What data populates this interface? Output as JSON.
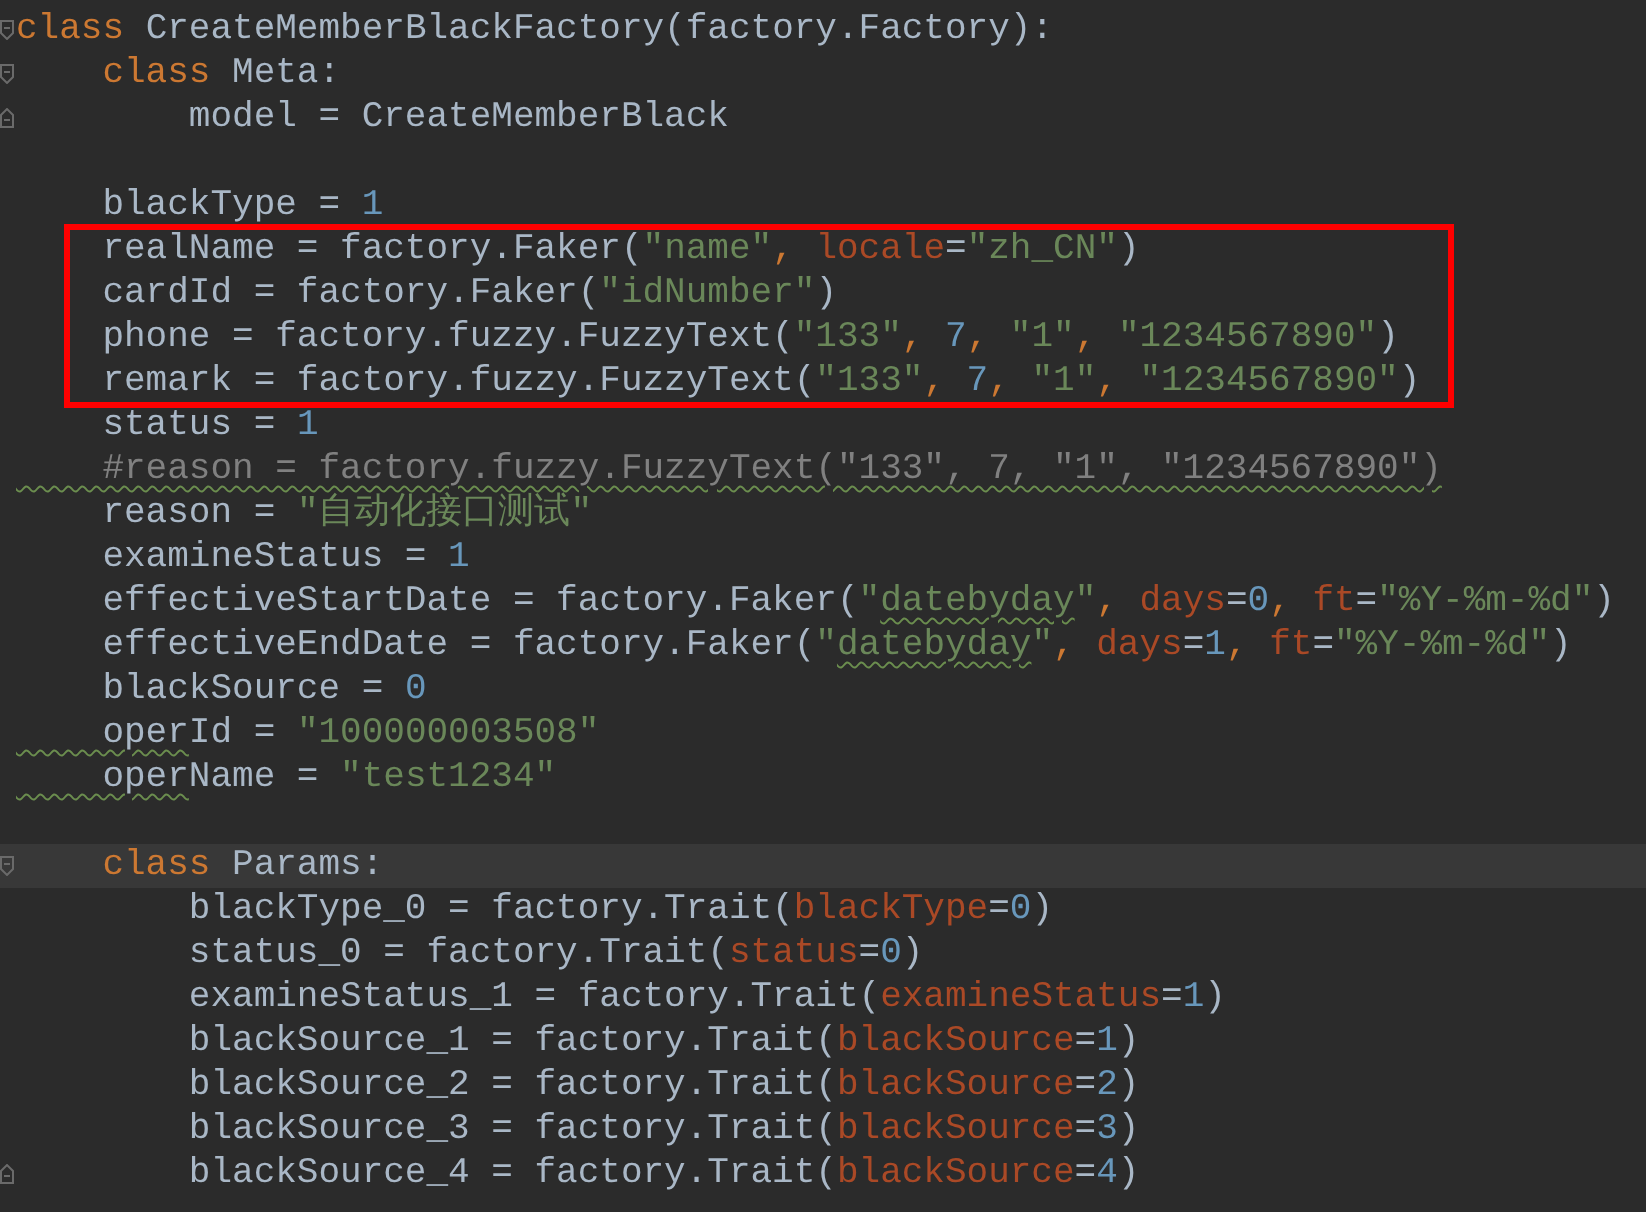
{
  "lines": [
    {
      "kind": "code",
      "fold_start": true,
      "fold_end": false,
      "current": false,
      "tokens": [
        {
          "kind": "keyword",
          "text": "class"
        },
        {
          "kind": "plain",
          "text": " CreateMemberBlackFactory(factory.Factory):"
        }
      ]
    },
    {
      "kind": "code",
      "fold_start": true,
      "fold_end": false,
      "current": false,
      "tokens": [
        {
          "kind": "keyword",
          "text": "    class"
        },
        {
          "kind": "plain",
          "text": " Meta:"
        }
      ]
    },
    {
      "kind": "code",
      "fold_start": false,
      "fold_end": true,
      "current": false,
      "tokens": [
        {
          "kind": "plain",
          "text": "        model = CreateMemberBlack"
        }
      ]
    },
    {
      "kind": "blank"
    },
    {
      "kind": "code",
      "fold_start": false,
      "fold_end": false,
      "current": false,
      "tokens": [
        {
          "kind": "plain",
          "text": "    blackType = "
        },
        {
          "kind": "number",
          "text": "1"
        }
      ]
    },
    {
      "kind": "boxed",
      "lines": [
        {
          "kind": "code",
          "fold_start": false,
          "fold_end": false,
          "current": false,
          "tokens": [
            {
              "kind": "plain",
              "text": "    realName = factory.Faker("
            },
            {
              "kind": "string",
              "text": "\"name\""
            },
            {
              "kind": "keyword",
              "text": ", "
            },
            {
              "kind": "argument",
              "text": "locale"
            },
            {
              "kind": "plain",
              "text": "="
            },
            {
              "kind": "string",
              "text": "\"zh_CN\""
            },
            {
              "kind": "plain",
              "text": ")"
            }
          ]
        },
        {
          "kind": "code",
          "fold_start": false,
          "fold_end": false,
          "current": false,
          "tokens": [
            {
              "kind": "plain",
              "text": "    cardId = factory.Faker("
            },
            {
              "kind": "string",
              "text": "\"idNumber\""
            },
            {
              "kind": "plain",
              "text": ")"
            }
          ]
        },
        {
          "kind": "code",
          "fold_start": false,
          "fold_end": false,
          "current": false,
          "tokens": [
            {
              "kind": "plain",
              "text": "    phone = factory.fuzzy.FuzzyText("
            },
            {
              "kind": "string",
              "text": "\"133\""
            },
            {
              "kind": "keyword",
              "text": ", "
            },
            {
              "kind": "number",
              "text": "7"
            },
            {
              "kind": "keyword",
              "text": ", "
            },
            {
              "kind": "string",
              "text": "\"1\""
            },
            {
              "kind": "keyword",
              "text": ", "
            },
            {
              "kind": "string",
              "text": "\"1234567890\""
            },
            {
              "kind": "plain",
              "text": ")"
            }
          ]
        },
        {
          "kind": "code",
          "fold_start": false,
          "fold_end": false,
          "current": false,
          "tokens": [
            {
              "kind": "plain",
              "text": "    remark = factory.fuzzy.FuzzyText("
            },
            {
              "kind": "string",
              "text": "\"133\""
            },
            {
              "kind": "keyword",
              "text": ", "
            },
            {
              "kind": "number",
              "text": "7"
            },
            {
              "kind": "keyword",
              "text": ", "
            },
            {
              "kind": "string",
              "text": "\"1\""
            },
            {
              "kind": "keyword",
              "text": ", "
            },
            {
              "kind": "string",
              "text": "\"1234567890\""
            },
            {
              "kind": "plain",
              "text": ")"
            }
          ]
        }
      ]
    },
    {
      "kind": "code",
      "fold_start": false,
      "fold_end": false,
      "current": false,
      "tokens": [
        {
          "kind": "plain",
          "text": "    status = "
        },
        {
          "kind": "number",
          "text": "1"
        }
      ]
    },
    {
      "kind": "code",
      "fold_start": false,
      "fold_end": false,
      "current": false,
      "tokens": [
        {
          "kind": "comment",
          "text": "    #reason = factory.fuzzy.FuzzyText(\"133\", 7, \"1\", \"1234567890\")",
          "typo": true
        }
      ]
    },
    {
      "kind": "code",
      "fold_start": false,
      "fold_end": false,
      "current": false,
      "tokens": [
        {
          "kind": "plain",
          "text": "    reason = "
        },
        {
          "kind": "string",
          "text": "\"自动化接口测试\""
        }
      ]
    },
    {
      "kind": "code",
      "fold_start": false,
      "fold_end": false,
      "current": false,
      "tokens": [
        {
          "kind": "plain",
          "text": "    examineStatus = "
        },
        {
          "kind": "number",
          "text": "1"
        }
      ]
    },
    {
      "kind": "code",
      "fold_start": false,
      "fold_end": false,
      "current": false,
      "tokens": [
        {
          "kind": "plain",
          "text": "    effectiveStartDate = factory.Faker("
        },
        {
          "kind": "string",
          "text": "\""
        },
        {
          "kind": "string",
          "text": "datebyday",
          "typo": true
        },
        {
          "kind": "string",
          "text": "\""
        },
        {
          "kind": "keyword",
          "text": ", "
        },
        {
          "kind": "argument",
          "text": "days"
        },
        {
          "kind": "plain",
          "text": "="
        },
        {
          "kind": "number",
          "text": "0"
        },
        {
          "kind": "keyword",
          "text": ", "
        },
        {
          "kind": "argument",
          "text": "ft"
        },
        {
          "kind": "plain",
          "text": "="
        },
        {
          "kind": "string",
          "text": "\"%Y-%m-%d\""
        },
        {
          "kind": "plain",
          "text": ")"
        }
      ]
    },
    {
      "kind": "code",
      "fold_start": false,
      "fold_end": false,
      "current": false,
      "tokens": [
        {
          "kind": "plain",
          "text": "    effectiveEndDate = factory.Faker("
        },
        {
          "kind": "string",
          "text": "\""
        },
        {
          "kind": "string",
          "text": "datebyday",
          "typo": true
        },
        {
          "kind": "string",
          "text": "\""
        },
        {
          "kind": "keyword",
          "text": ", "
        },
        {
          "kind": "argument",
          "text": "days"
        },
        {
          "kind": "plain",
          "text": "="
        },
        {
          "kind": "number",
          "text": "1"
        },
        {
          "kind": "keyword",
          "text": ", "
        },
        {
          "kind": "argument",
          "text": "ft"
        },
        {
          "kind": "plain",
          "text": "="
        },
        {
          "kind": "string",
          "text": "\"%Y-%m-%d\""
        },
        {
          "kind": "plain",
          "text": ")"
        }
      ]
    },
    {
      "kind": "code",
      "fold_start": false,
      "fold_end": false,
      "current": false,
      "tokens": [
        {
          "kind": "plain",
          "text": "    blackSource = "
        },
        {
          "kind": "number",
          "text": "0"
        }
      ]
    },
    {
      "kind": "code",
      "fold_start": false,
      "fold_end": false,
      "current": false,
      "tokens": [
        {
          "kind": "plain",
          "text": "    oper",
          "typo": true
        },
        {
          "kind": "plain",
          "text": "Id = "
        },
        {
          "kind": "string",
          "text": "\"100000003508\""
        }
      ]
    },
    {
      "kind": "code",
      "fold_start": false,
      "fold_end": false,
      "current": false,
      "tokens": [
        {
          "kind": "plain",
          "text": "    oper",
          "typo": true
        },
        {
          "kind": "plain",
          "text": "Name = "
        },
        {
          "kind": "string",
          "text": "\"test1234\""
        }
      ]
    },
    {
      "kind": "blank"
    },
    {
      "kind": "code",
      "fold_start": true,
      "fold_end": false,
      "current": true,
      "tokens": [
        {
          "kind": "keyword",
          "text": "    class"
        },
        {
          "kind": "plain",
          "text": " Params:"
        }
      ]
    },
    {
      "kind": "code",
      "fold_start": false,
      "fold_end": false,
      "current": false,
      "tokens": [
        {
          "kind": "plain",
          "text": "        blackType_0 = factory.Trait("
        },
        {
          "kind": "argument",
          "text": "blackType"
        },
        {
          "kind": "plain",
          "text": "="
        },
        {
          "kind": "number",
          "text": "0"
        },
        {
          "kind": "plain",
          "text": ")"
        }
      ]
    },
    {
      "kind": "code",
      "fold_start": false,
      "fold_end": false,
      "current": false,
      "tokens": [
        {
          "kind": "plain",
          "text": "        status_0 = factory.Trait("
        },
        {
          "kind": "argument",
          "text": "status"
        },
        {
          "kind": "plain",
          "text": "="
        },
        {
          "kind": "number",
          "text": "0"
        },
        {
          "kind": "plain",
          "text": ")"
        }
      ]
    },
    {
      "kind": "code",
      "fold_start": false,
      "fold_end": false,
      "current": false,
      "tokens": [
        {
          "kind": "plain",
          "text": "        examineStatus_1 = factory.Trait("
        },
        {
          "kind": "argument",
          "text": "examineStatus"
        },
        {
          "kind": "plain",
          "text": "="
        },
        {
          "kind": "number",
          "text": "1"
        },
        {
          "kind": "plain",
          "text": ")"
        }
      ]
    },
    {
      "kind": "code",
      "fold_start": false,
      "fold_end": false,
      "current": false,
      "tokens": [
        {
          "kind": "plain",
          "text": "        blackSource_1 = factory.Trait("
        },
        {
          "kind": "argument",
          "text": "blackSource"
        },
        {
          "kind": "plain",
          "text": "="
        },
        {
          "kind": "number",
          "text": "1"
        },
        {
          "kind": "plain",
          "text": ")"
        }
      ]
    },
    {
      "kind": "code",
      "fold_start": false,
      "fold_end": false,
      "current": false,
      "tokens": [
        {
          "kind": "plain",
          "text": "        blackSource_2 = factory.Trait("
        },
        {
          "kind": "argument",
          "text": "blackSource"
        },
        {
          "kind": "plain",
          "text": "="
        },
        {
          "kind": "number",
          "text": "2"
        },
        {
          "kind": "plain",
          "text": ")"
        }
      ]
    },
    {
      "kind": "code",
      "fold_start": false,
      "fold_end": false,
      "current": false,
      "tokens": [
        {
          "kind": "plain",
          "text": "        blackSource_3 = factory.Trait("
        },
        {
          "kind": "argument",
          "text": "blackSource"
        },
        {
          "kind": "plain",
          "text": "="
        },
        {
          "kind": "number",
          "text": "3"
        },
        {
          "kind": "plain",
          "text": ")"
        }
      ]
    },
    {
      "kind": "code",
      "fold_start": false,
      "fold_end": true,
      "current": false,
      "tokens": [
        {
          "kind": "plain",
          "text": "        blackSource_4 = factory.Trait("
        },
        {
          "kind": "argument",
          "text": "blackSource"
        },
        {
          "kind": "plain",
          "text": "="
        },
        {
          "kind": "number",
          "text": "4"
        },
        {
          "kind": "plain",
          "text": ")"
        }
      ]
    }
  ]
}
